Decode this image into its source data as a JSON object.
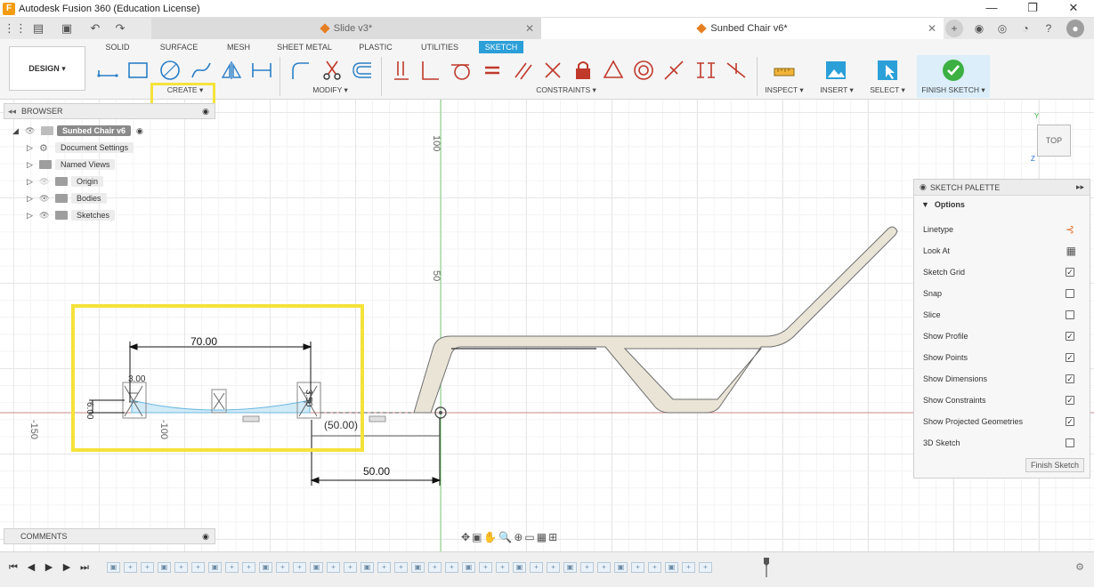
{
  "window": {
    "title": "Autodesk Fusion 360 (Education License)",
    "minimize_glyph": "—",
    "restore_glyph": "❐",
    "close_glyph": "✕"
  },
  "tabs": [
    {
      "label": "Slide v3*",
      "close": "✕"
    },
    {
      "label": "Sunbed Chair v6*",
      "close": "✕"
    }
  ],
  "ribbon": {
    "workspace": "DESIGN ▾",
    "tabs": [
      "SOLID",
      "SURFACE",
      "MESH",
      "SHEET METAL",
      "PLASTIC",
      "UTILITIES",
      "SKETCH"
    ],
    "active_tab": "SKETCH",
    "groups": {
      "create": "CREATE ▾",
      "modify": "MODIFY ▾",
      "constraints": "CONSTRAINTS ▾",
      "inspect": "INSPECT ▾",
      "insert": "INSERT ▾",
      "select": "SELECT ▾",
      "finish": "FINISH SKETCH ▾"
    }
  },
  "browser": {
    "title": "BROWSER",
    "root": "Sunbed Chair v6",
    "items": [
      {
        "label": "Document Settings",
        "icon": "gear-icon"
      },
      {
        "label": "Named Views",
        "icon": "folder-icon"
      },
      {
        "label": "Origin",
        "icon": "folder-icon"
      },
      {
        "label": "Bodies",
        "icon": "folder-icon"
      },
      {
        "label": "Sketches",
        "icon": "folder-icon"
      }
    ]
  },
  "canvas": {
    "axis_labels": {
      "v100": "100",
      "v50": "50",
      "h_minus150": "-150",
      "h_minus100": "-100"
    },
    "dimensions": {
      "d70": "70.00",
      "d50": "50.00",
      "d50_ref": "(50.00)",
      "d3": "3.00",
      "d6": "6.00",
      "d3_5": "3.50"
    },
    "viewcube": "TOP",
    "axis_y": "Y",
    "axis_z": "Z"
  },
  "palette": {
    "title": "SKETCH PALETTE",
    "section": "Options",
    "rows": [
      {
        "label": "Linetype",
        "type": "icon"
      },
      {
        "label": "Look At",
        "type": "icon"
      },
      {
        "label": "Sketch Grid",
        "checked": true
      },
      {
        "label": "Snap",
        "checked": false
      },
      {
        "label": "Slice",
        "checked": false
      },
      {
        "label": "Show Profile",
        "checked": true
      },
      {
        "label": "Show Points",
        "checked": true
      },
      {
        "label": "Show Dimensions",
        "checked": true
      },
      {
        "label": "Show Constraints",
        "checked": true
      },
      {
        "label": "Show Projected Geometries",
        "checked": true
      },
      {
        "label": "3D Sketch",
        "checked": false
      }
    ],
    "finish_button": "Finish Sketch"
  },
  "comments": {
    "title": "COMMENTS"
  },
  "colors": {
    "accent": "#2b9fd8",
    "highlight": "#f5e23a",
    "chair_fill": "#e9e4d6",
    "finish_green": "#3cb043",
    "profile_blue": "#bfe3f5"
  }
}
